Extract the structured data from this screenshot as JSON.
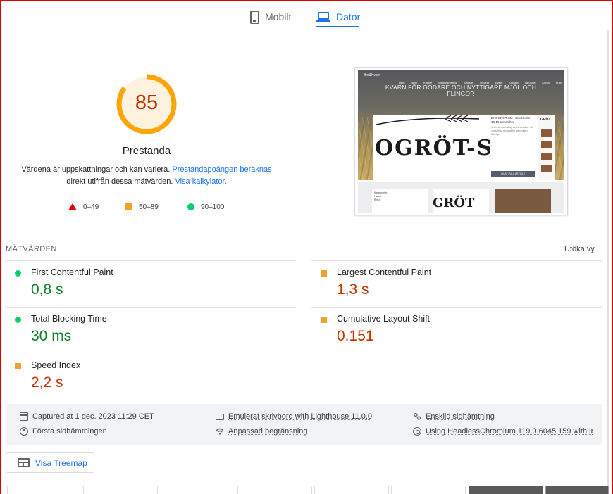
{
  "tabs": {
    "mobile_label": "Mobilt",
    "desktop_label": "Dator",
    "active": "desktop"
  },
  "performance": {
    "score": "85",
    "title": "Prestanda",
    "desc_prefix": "Värdena är uppskattningar och kan variera. ",
    "desc_link1": "Prestandapoängen beräknas",
    "desc_middle": " direkt utifrån dessa mätvärden. ",
    "desc_link2": "Visa kalkylator",
    "desc_suffix": ".",
    "score_fraction": 0.85,
    "colors": {
      "average": "#ffa400",
      "fail": "#e00000",
      "pass": "#0cce6b"
    },
    "legend": {
      "fail": "0–49",
      "average": "50–89",
      "pass": "90–100"
    }
  },
  "screenshot": {
    "site_logo": "Bro&Kvarn",
    "nav": [
      "Hem",
      "Butik",
      "Kurser",
      "Stenkvarnsmjöl",
      "Tjänster",
      "Recept",
      "Event",
      "Kontakt",
      "Varukorg",
      "Konto",
      "Publ."
    ],
    "heading": "KVARN FÖR GODARE OCH NYTTIGARE MJÖL OCH FLINGOR",
    "card_logo": "OGRÖT-S",
    "card_side_title": "EKOGRÖT-SM I Stockholm 18-19 november",
    "card_side_text": "Vet ni ta beredskap av ett förstärkt, att vår största ekologiska havregryn i Sverige",
    "card_button": "VISAT FULL ARTIKLE",
    "card_brand": "GRÖT",
    "lower_box_title": "Kategorier",
    "lower_box_items": [
      "Havre",
      "Bröd"
    ],
    "lower_logo": "GRÖT"
  },
  "metrics": {
    "heading": "MÄTVÄRDEN",
    "expand_label": "Utöka vy",
    "fcp": {
      "label": "First Contentful Paint",
      "value": "0,8 s",
      "rating": "pass"
    },
    "lcp": {
      "label": "Largest Contentful Paint",
      "value": "1,3 s",
      "rating": "average"
    },
    "tbt": {
      "label": "Total Blocking Time",
      "value": "30 ms",
      "rating": "pass"
    },
    "cls": {
      "label": "Cumulative Layout Shift",
      "value": "0.151",
      "rating": "average"
    },
    "si": {
      "label": "Speed Index",
      "value": "2,2 s",
      "rating": "average"
    }
  },
  "run_info": {
    "captured": "Captured at 1 dec. 2023 11:29 CET",
    "first_load": "Första sidhämtningen",
    "emulated": "Emulerat skrivbord with Lighthouse 11.0.0",
    "throttling": "Anpassad begränsning",
    "single_load": "Enskild sidhämtning",
    "browser": "Using HeadlessChromium 119.0.6045.159 with lr"
  },
  "treemap_label": "Visa Treemap"
}
